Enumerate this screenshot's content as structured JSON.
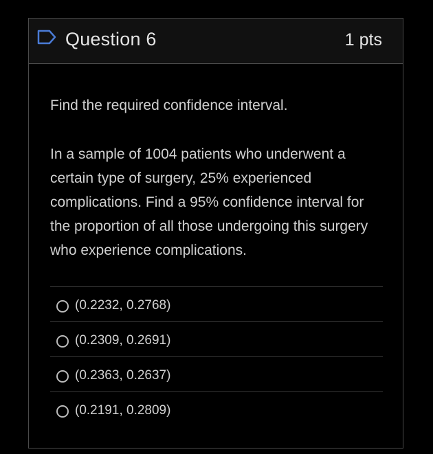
{
  "question": {
    "title": "Question 6",
    "points": "1 pts",
    "instruction": "Find the required confidence interval.",
    "problem": "In a sample of 1004 patients who underwent a certain type of surgery, 25% experienced complications. Find a 95% confidence interval for the proportion of all those undergoing this surgery who experience complications."
  },
  "answers": [
    {
      "label": "(0.2232, 0.2768)"
    },
    {
      "label": "(0.2309, 0.2691)"
    },
    {
      "label": "(0.2363, 0.2637)"
    },
    {
      "label": "(0.2191, 0.2809)"
    }
  ],
  "colors": {
    "background": "#000000",
    "header": "#111111",
    "border": "#4a4a4a",
    "text": "#d0d0d0"
  }
}
